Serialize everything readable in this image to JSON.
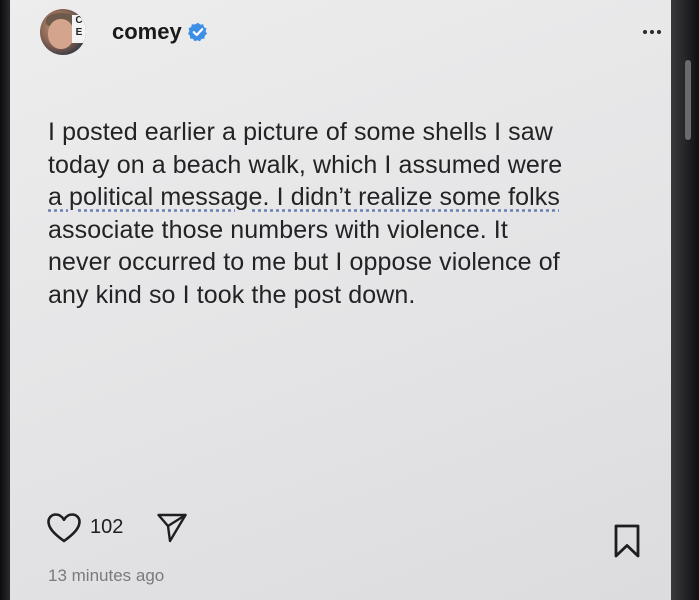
{
  "post": {
    "author": {
      "username": "comey",
      "verified": true,
      "avatar_sign_text": "C\nE"
    },
    "text_lines": [
      "I posted earlier a picture of some shells I saw",
      "today on a beach walk, which I assumed were",
      "a political message. I didn’t realize some folks",
      "associate those numbers with violence. It",
      "never occurred to me but I oppose violence of",
      "any kind so I took the post down."
    ],
    "like_count": "102",
    "timestamp": "13 minutes ago"
  },
  "icons": {
    "verified": "verified-badge-icon",
    "more": "more-options-icon",
    "like": "heart-icon",
    "share": "paper-plane-icon",
    "bookmark": "bookmark-icon"
  },
  "colors": {
    "verified_badge": "#3d8fe6",
    "background": "#e8e8ea",
    "text": "#232325",
    "timestamp": "#7a7a7e"
  }
}
